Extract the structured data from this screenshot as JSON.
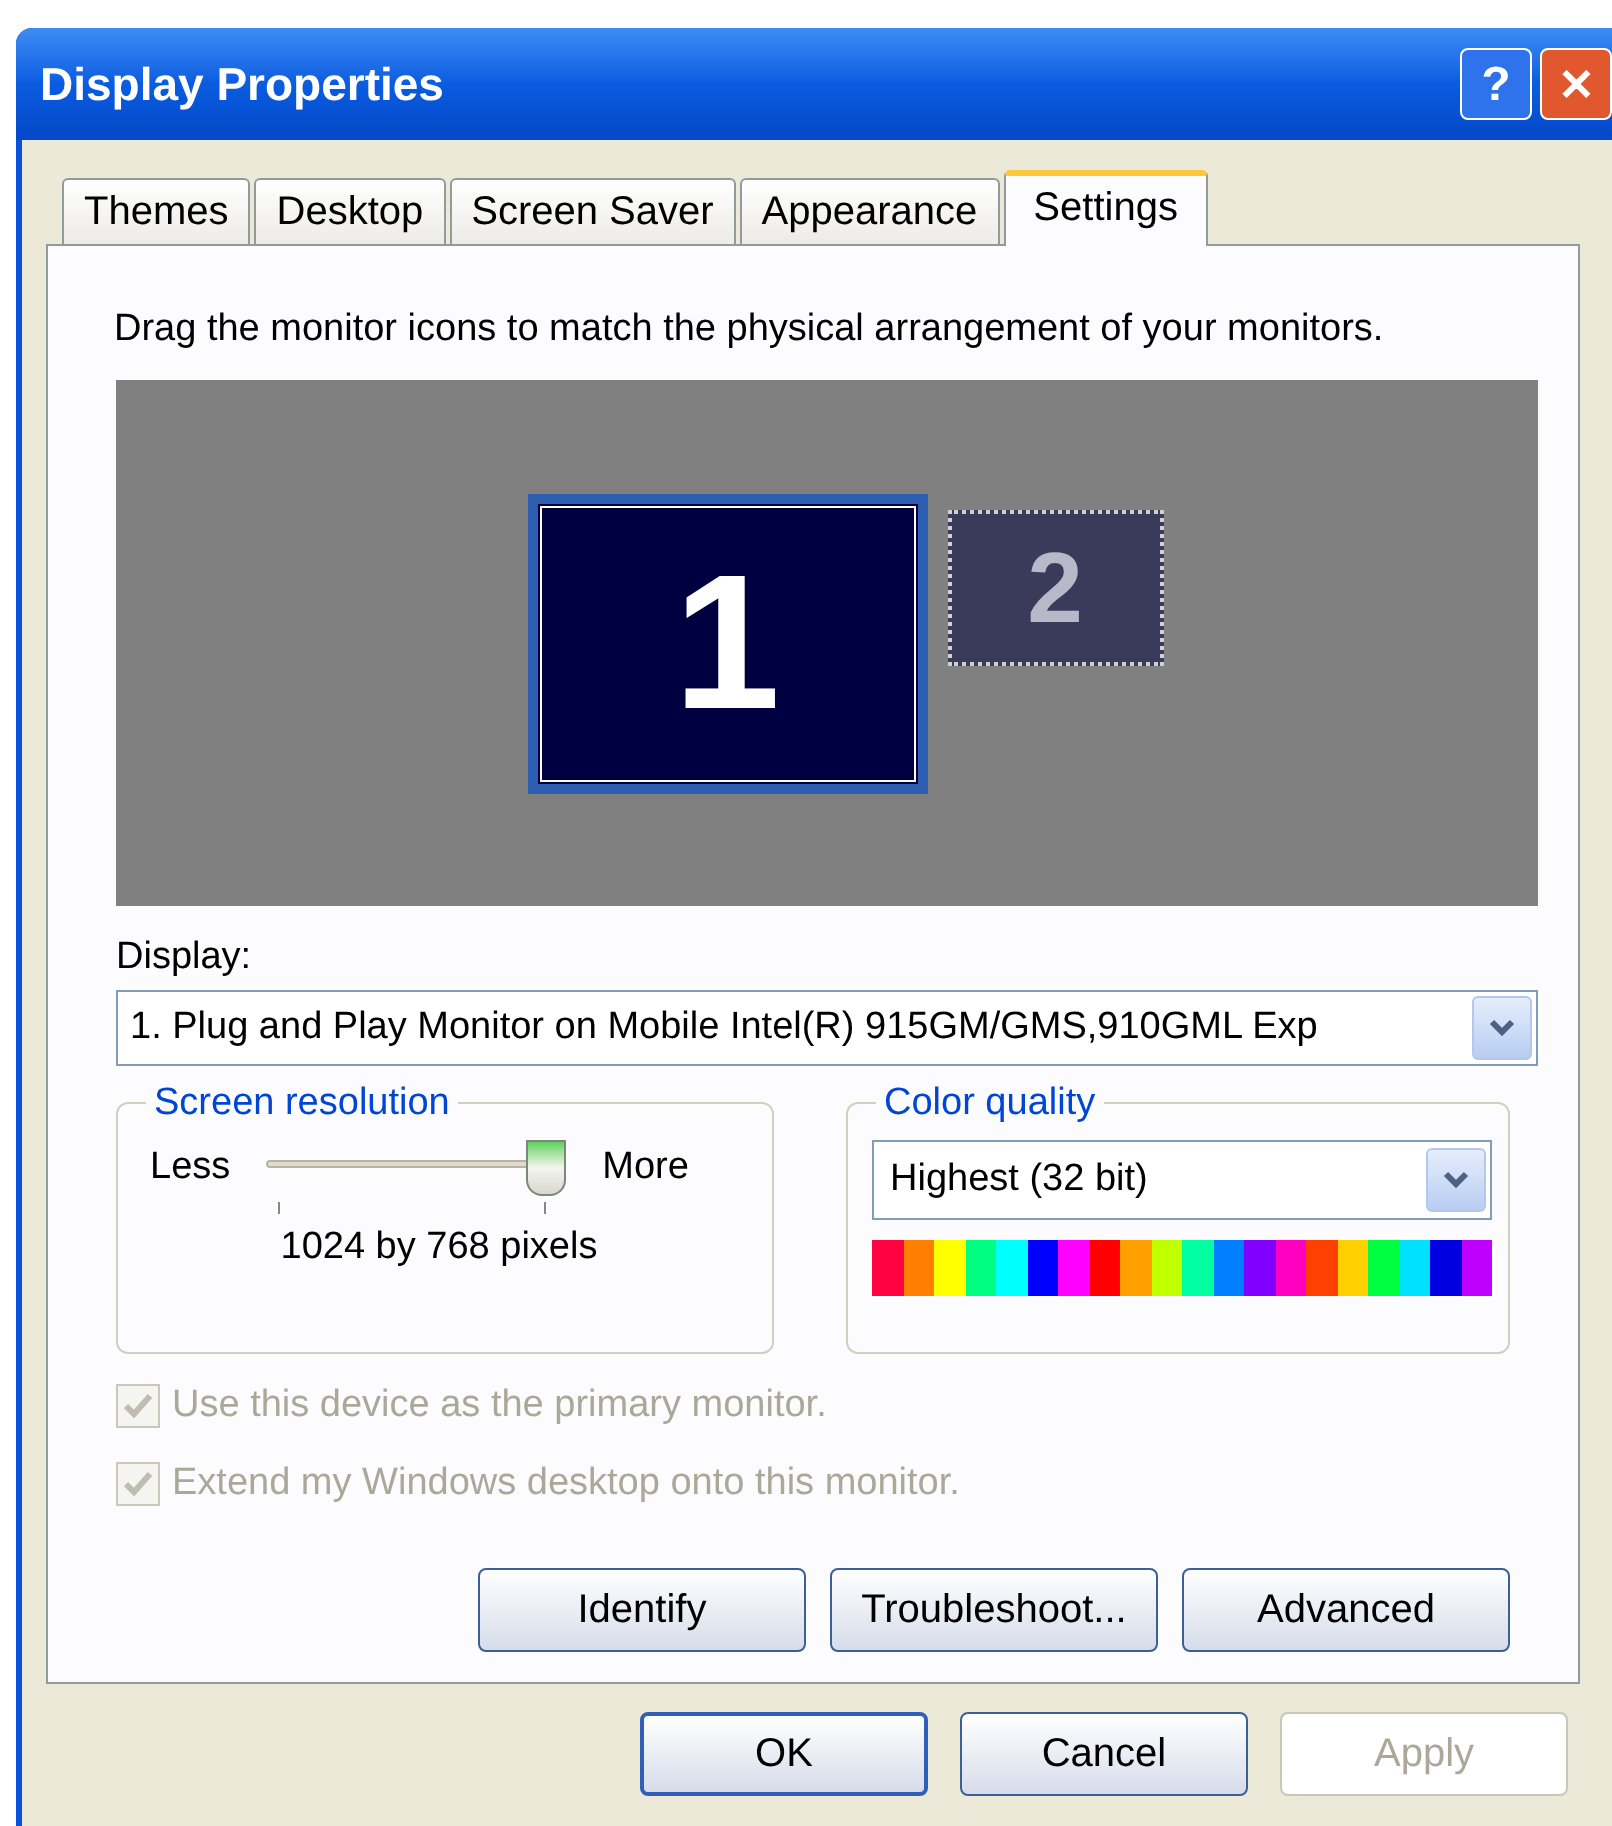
{
  "window": {
    "title": "Display Properties",
    "title_buttons": [
      "?",
      "✕"
    ]
  },
  "tabs": [
    {
      "label": "Themes",
      "selected": false
    },
    {
      "label": "Desktop",
      "selected": false
    },
    {
      "label": "Screen Saver",
      "selected": false
    },
    {
      "label": "Appearance",
      "selected": false
    },
    {
      "label": "Settings",
      "selected": true
    }
  ],
  "instructions": "Drag the monitor icons to match the physical arrangement of your monitors.",
  "monitors": [
    {
      "number": "1",
      "selected": true
    },
    {
      "number": "2",
      "selected": false
    }
  ],
  "display": {
    "label": "Display:",
    "value": "1. Plug and Play Monitor on Mobile Intel(R) 915GM/GMS,910GML Exp"
  },
  "screen_resolution": {
    "title": "Screen resolution",
    "less": "Less",
    "more": "More",
    "level": 1,
    "reading": "1024 by 768 pixels"
  },
  "color_quality": {
    "title": "Color quality",
    "value": "Highest (32 bit)"
  },
  "checkboxes": [
    {
      "label": "Use this device as the primary monitor.",
      "checked": true,
      "disabled": true
    },
    {
      "label": "Extend my Windows desktop onto this monitor.",
      "checked": true,
      "disabled": true
    }
  ],
  "panel_buttons": [
    {
      "label": "Identify",
      "disabled": false
    },
    {
      "label": "Troubleshoot...",
      "disabled": false
    },
    {
      "label": "Advanced",
      "disabled": false
    }
  ],
  "dialog_buttons": [
    {
      "label": "OK",
      "default": true,
      "disabled": false
    },
    {
      "label": "Cancel",
      "default": false,
      "disabled": false
    },
    {
      "label": "Apply",
      "default": false,
      "disabled": true
    }
  ]
}
